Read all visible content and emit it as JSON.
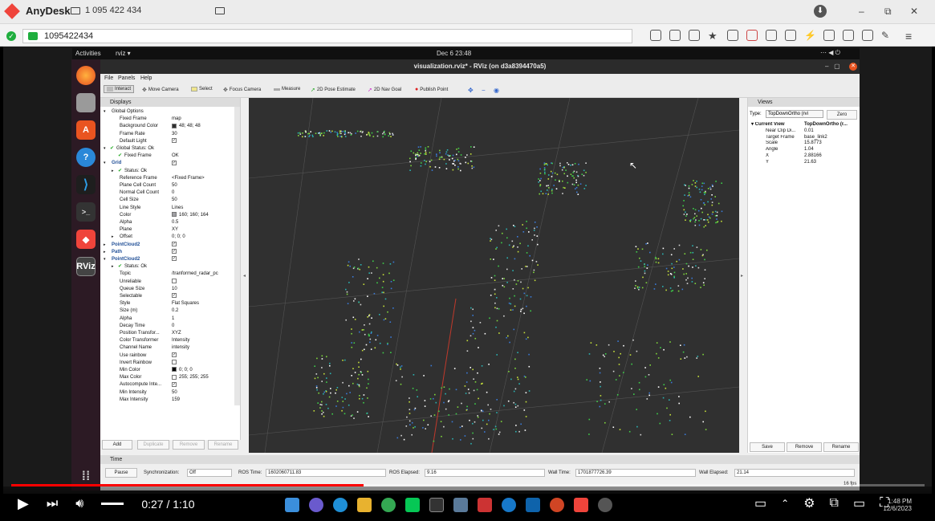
{
  "anydesk": {
    "app_name": "AnyDesk",
    "tab_label": "1 095 422 434",
    "address": "1095422434",
    "window_controls": {
      "minimize": "–",
      "maximize": "⧉",
      "close": "✕"
    },
    "menu_icon": "≡"
  },
  "gnome": {
    "activities": "Activities",
    "app": "rviz ▾",
    "clock": "Dec 6  23:48"
  },
  "rviz": {
    "title": "visualization.rviz* - RViz (on d3a8394470a5)",
    "menu": [
      "File",
      "Panels",
      "Help"
    ],
    "toolbar": [
      "Interact",
      "Move Camera",
      "Select",
      "Focus Camera",
      "Measure",
      "2D Pose Estimate",
      "2D Nav Goal",
      "Publish Point"
    ],
    "displays_title": "Displays",
    "display_rows": [
      {
        "k": "Global Options",
        "v": "",
        "indent": 1,
        "arrow": "▾",
        "icon": "globe",
        "blue": false
      },
      {
        "k": "Fixed Frame",
        "v": "map",
        "indent": 2
      },
      {
        "k": "Background Color",
        "v": "48; 48; 48",
        "indent": 2,
        "swatch": "#303030"
      },
      {
        "k": "Frame Rate",
        "v": "30",
        "indent": 2
      },
      {
        "k": "Default Light",
        "v": "",
        "indent": 2,
        "check": "✓"
      },
      {
        "k": "Global Status: Ok",
        "v": "",
        "indent": 1,
        "arrow": "▾",
        "tick": true
      },
      {
        "k": "Fixed Frame",
        "v": "OK",
        "indent": 2,
        "tick": true
      },
      {
        "k": "Grid",
        "v": "",
        "indent": 1,
        "arrow": "▾",
        "blue": true,
        "check": "✓"
      },
      {
        "k": "Status: Ok",
        "v": "",
        "indent": 2,
        "arrow": "▸",
        "tick": true
      },
      {
        "k": "Reference Frame",
        "v": "<Fixed Frame>",
        "indent": 2
      },
      {
        "k": "Plane Cell Count",
        "v": "50",
        "indent": 2
      },
      {
        "k": "Normal Cell Count",
        "v": "0",
        "indent": 2
      },
      {
        "k": "Cell Size",
        "v": "50",
        "indent": 2
      },
      {
        "k": "Line Style",
        "v": "Lines",
        "indent": 2
      },
      {
        "k": "Color",
        "v": "160; 160; 164",
        "indent": 2,
        "swatch": "#a0a0a4"
      },
      {
        "k": "Alpha",
        "v": "0.5",
        "indent": 2
      },
      {
        "k": "Plane",
        "v": "XY",
        "indent": 2
      },
      {
        "k": "Offset",
        "v": "0; 0; 0",
        "indent": 2,
        "arrow": "▸"
      },
      {
        "k": "PointCloud2",
        "v": "",
        "indent": 1,
        "arrow": "▸",
        "blue": true,
        "check": "✓"
      },
      {
        "k": "Path",
        "v": "",
        "indent": 1,
        "arrow": "▸",
        "blue": true,
        "check": "✓"
      },
      {
        "k": "PointCloud2",
        "v": "",
        "indent": 1,
        "arrow": "▾",
        "blue": true,
        "check": "✓"
      },
      {
        "k": "Status: Ok",
        "v": "",
        "indent": 2,
        "arrow": "▸",
        "tick": true
      },
      {
        "k": "Topic",
        "v": "/tranformed_radar_pc",
        "indent": 2
      },
      {
        "k": "Unreliable",
        "v": "",
        "indent": 2,
        "check": ""
      },
      {
        "k": "Queue Size",
        "v": "10",
        "indent": 2
      },
      {
        "k": "Selectable",
        "v": "",
        "indent": 2,
        "check": "✓"
      },
      {
        "k": "Style",
        "v": "Flat Squares",
        "indent": 2
      },
      {
        "k": "Size (m)",
        "v": "0.2",
        "indent": 2
      },
      {
        "k": "Alpha",
        "v": "1",
        "indent": 2
      },
      {
        "k": "Decay Time",
        "v": "0",
        "indent": 2
      },
      {
        "k": "Position Transfor...",
        "v": "XYZ",
        "indent": 2
      },
      {
        "k": "Color Transformer",
        "v": "Intensity",
        "indent": 2
      },
      {
        "k": "Channel Name",
        "v": "intensity",
        "indent": 2
      },
      {
        "k": "Use rainbow",
        "v": "",
        "indent": 2,
        "check": "✓"
      },
      {
        "k": "Invert Rainbow",
        "v": "",
        "indent": 2,
        "check": ""
      },
      {
        "k": "Min Color",
        "v": "0; 0; 0",
        "indent": 2,
        "swatch": "#000000"
      },
      {
        "k": "Max Color",
        "v": "255; 255; 255",
        "indent": 2,
        "swatch": "#ffffff"
      },
      {
        "k": "Autocompute Inte...",
        "v": "",
        "indent": 2,
        "check": "✓"
      },
      {
        "k": "Min Intensity",
        "v": "50",
        "indent": 2
      },
      {
        "k": "Max Intensity",
        "v": "159",
        "indent": 2
      }
    ],
    "display_buttons": [
      "Add",
      "Duplicate",
      "Remove",
      "Rename"
    ],
    "views": {
      "title": "Views",
      "type_label": "Type:",
      "type_value": "TopDownOrtho (rvi",
      "zero": "Zero",
      "rows": [
        {
          "k": "Current View",
          "v": "TopDownOrtho (r...",
          "bold": true
        },
        {
          "k": "Near Clip Di...",
          "v": "0.01"
        },
        {
          "k": "Target Frame",
          "v": "base_link2"
        },
        {
          "k": "Scale",
          "v": "15.8773"
        },
        {
          "k": "Angle",
          "v": "1.04"
        },
        {
          "k": "X",
          "v": "2.88166"
        },
        {
          "k": "Y",
          "v": "21.63"
        }
      ],
      "buttons": [
        "Save",
        "Remove",
        "Rename"
      ]
    },
    "time": {
      "title": "Time",
      "pause": "Pause",
      "sync_label": "Synchronization:",
      "sync_value": "Off",
      "ros_time_label": "ROS Time:",
      "ros_time": "1602060711.83",
      "ros_elapsed_label": "ROS Elapsed:",
      "ros_elapsed": "9.16",
      "wall_time_label": "Wall Time:",
      "wall_time": "1701877726.39",
      "wall_elapsed_label": "Wall Elapsed:",
      "wall_elapsed": "21.14",
      "fps": "16 fps"
    }
  },
  "youtube": {
    "time": "0:27 / 1:10",
    "progress_fraction": 0.386,
    "clock_time": "1:48 PM",
    "clock_date": "12/6/2023"
  }
}
